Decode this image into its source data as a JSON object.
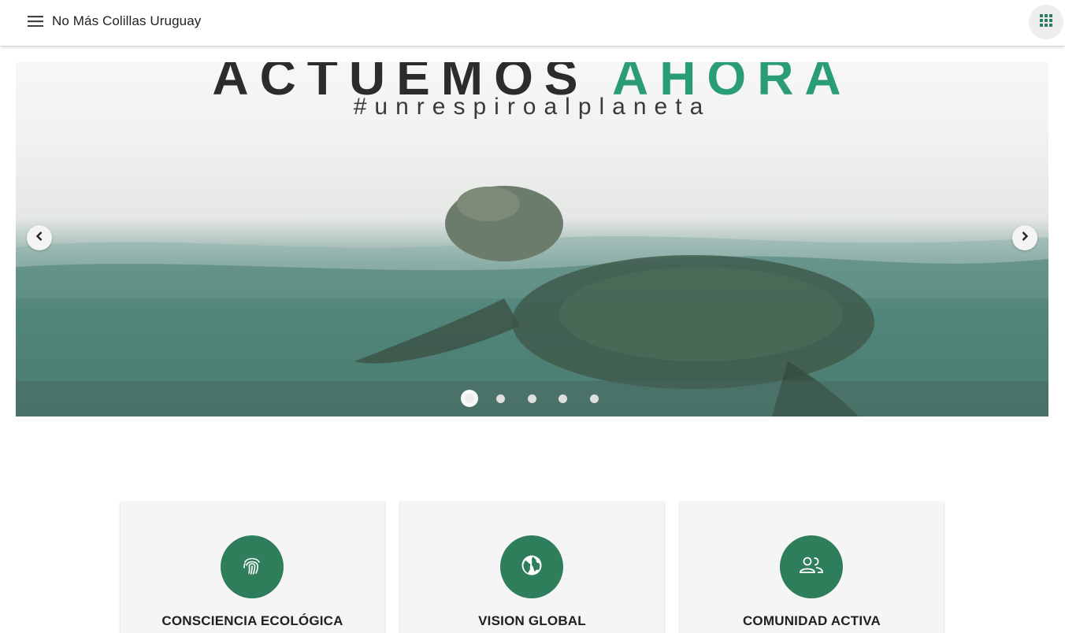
{
  "header": {
    "title": "No Más Colillas Uruguay",
    "menu_icon": "menu-icon",
    "apps_icon": "apps-icon"
  },
  "carousel": {
    "headline_part1": "ACTUEMOS",
    "headline_part2": "AHORA",
    "hashtag": "#unrespiroalplaneta",
    "slide_count": 5,
    "active_slide": 1,
    "prev_icon": "chevron-left-icon",
    "next_icon": "chevron-right-icon",
    "accent_color": "#2a9d74"
  },
  "features": [
    {
      "title": "CONSCIENCIA ECOLÓGICA",
      "icon": "fingerprint-icon"
    },
    {
      "title": "VISION GLOBAL",
      "icon": "globe-icon"
    },
    {
      "title": "COMUNIDAD ACTIVA",
      "icon": "people-icon"
    }
  ],
  "colors": {
    "primary": "#2e7d5b",
    "card_background": "#f5f5f5"
  }
}
